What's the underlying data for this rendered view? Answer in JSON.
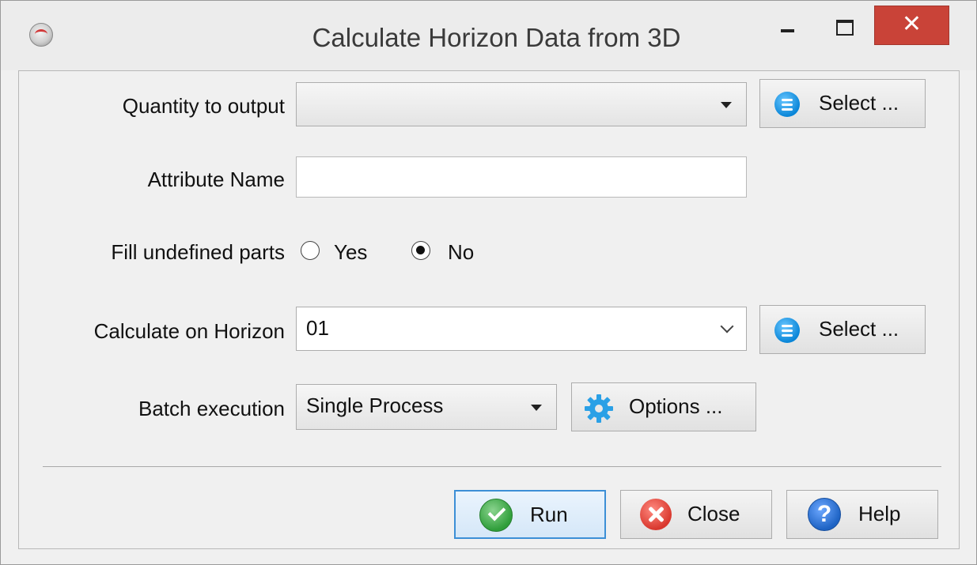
{
  "window": {
    "title": "Calculate Horizon Data from 3D",
    "close_glyph": "✕"
  },
  "form": {
    "quantity_label": "Quantity to output",
    "quantity_value": "",
    "quantity_select_label": "Select ...",
    "attribute_label": "Attribute Name",
    "attribute_value": "",
    "fill_label": "Fill undefined parts",
    "fill_yes_label": "Yes",
    "fill_no_label": "No",
    "fill_selected": "No",
    "horizon_label": "Calculate on Horizon",
    "horizon_value": "01",
    "horizon_select_label": "Select ...",
    "batch_label": "Batch execution",
    "batch_value": "Single Process",
    "batch_options_label": "Options ..."
  },
  "footer": {
    "run_label": "Run",
    "close_label": "Close",
    "help_label": "Help"
  },
  "icons": {
    "app": "app-logo-icon",
    "select": "list-icon",
    "options": "gear-icon",
    "run": "checkmark-icon",
    "close": "close-circle-icon",
    "help": "help-icon"
  },
  "colors": {
    "accent_blue": "#0a86d8",
    "run_green": "#2f9e3a",
    "close_red": "#d9382e",
    "help_blue": "#1e63c4",
    "titlebar_close": "#c94338"
  }
}
